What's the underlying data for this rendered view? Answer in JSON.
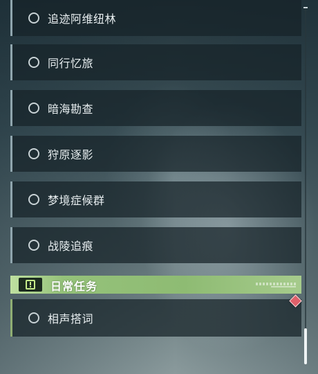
{
  "quests": [
    {
      "label": "追迹阿维纽林"
    },
    {
      "label": "同行忆旅"
    },
    {
      "label": "暗海勘查"
    },
    {
      "label": "狩原逐影"
    },
    {
      "label": "梦境症候群"
    },
    {
      "label": "战陵追痕"
    }
  ],
  "daily_section": {
    "title": "日常任务",
    "icon": "alert-square-icon",
    "accent_color": "#95c27a",
    "items": [
      {
        "label": "相声搭词",
        "badge_icon": "red-diamond-icon"
      }
    ]
  }
}
